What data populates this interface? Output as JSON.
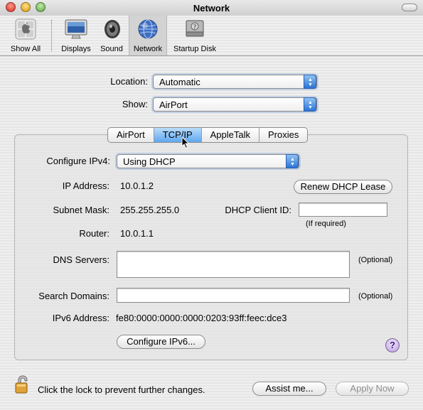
{
  "window": {
    "title": "Network"
  },
  "toolbar": {
    "items": [
      {
        "label": "Show All",
        "icon": "apple-logo-icon"
      },
      {
        "label": "Displays",
        "icon": "display-icon"
      },
      {
        "label": "Sound",
        "icon": "speaker-icon"
      },
      {
        "label": "Network",
        "icon": "globe-icon",
        "selected": true
      },
      {
        "label": "Startup Disk",
        "icon": "hard-disk-icon"
      }
    ]
  },
  "location": {
    "label": "Location:",
    "value": "Automatic"
  },
  "show": {
    "label": "Show:",
    "value": "AirPort"
  },
  "tabs": [
    {
      "label": "AirPort"
    },
    {
      "label": "TCP/IP",
      "active": true
    },
    {
      "label": "AppleTalk"
    },
    {
      "label": "Proxies"
    }
  ],
  "tcpip": {
    "configure_label": "Configure IPv4:",
    "configure_value": "Using DHCP",
    "ip_label": "IP Address:",
    "ip_value": "10.0.1.2",
    "renew_button": "Renew DHCP Lease",
    "subnet_label": "Subnet Mask:",
    "subnet_value": "255.255.255.0",
    "client_id_label": "DHCP Client ID:",
    "client_id_value": "",
    "client_id_hint": "(If required)",
    "router_label": "Router:",
    "router_value": "10.0.1.1",
    "dns_label": "DNS Servers:",
    "dns_value": "",
    "dns_hint": "(Optional)",
    "search_label": "Search Domains:",
    "search_value": "",
    "search_hint": "(Optional)",
    "ipv6_label": "IPv6 Address:",
    "ipv6_value": "fe80:0000:0000:0000:0203:93ff:feec:dce3",
    "configure_ipv6_button": "Configure IPv6...",
    "help_glyph": "?"
  },
  "footer": {
    "lock_text": "Click the lock to prevent further changes.",
    "assist_button": "Assist me...",
    "apply_button": "Apply Now"
  },
  "colors": {
    "accent": "#5ea7ef",
    "popup_arrows": "#2a74d6"
  }
}
